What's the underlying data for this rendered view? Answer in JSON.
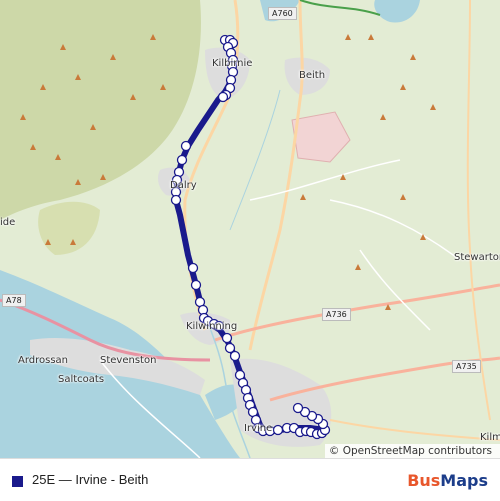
{
  "map": {
    "places": [
      {
        "id": "kilbirnie",
        "name": "Kilbirnie"
      },
      {
        "id": "beith",
        "name": "Beith"
      },
      {
        "id": "dalry",
        "name": "Dalry"
      },
      {
        "id": "kilwinning",
        "name": "Kilwinning"
      },
      {
        "id": "stevenston",
        "name": "Stevenston"
      },
      {
        "id": "saltcoats",
        "name": "Saltcoats"
      },
      {
        "id": "ardrossan",
        "name": "Ardrossan"
      },
      {
        "id": "stewarton",
        "name": "Stewarton"
      },
      {
        "id": "irvine",
        "name": "Irvine"
      },
      {
        "id": "kilmaurs",
        "name": "Kilm"
      },
      {
        "id": "largs-side",
        "name": "ide"
      }
    ],
    "roads": [
      "A760",
      "A78",
      "A736",
      "A735"
    ],
    "route_color": "#1a1a8c",
    "stop_color": "#ffffff",
    "attribution": "© OpenStreetMap contributors"
  },
  "legend": {
    "route_label": "25E — Irvine - Beith",
    "route_color": "#1a1a8c"
  },
  "brand": {
    "part1": "Bus",
    "part2": "Maps"
  }
}
